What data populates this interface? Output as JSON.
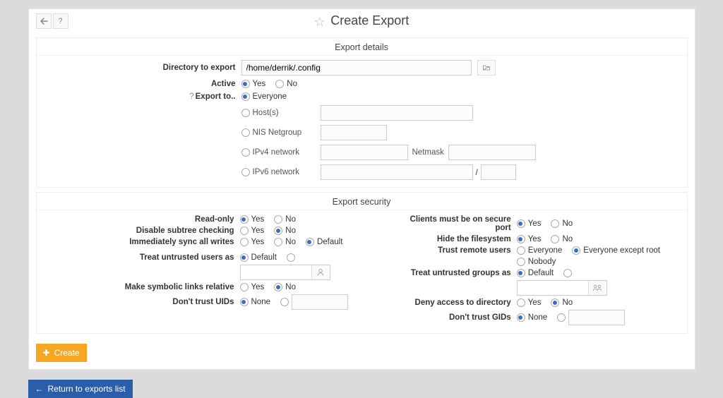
{
  "title": "Create Export",
  "sections": {
    "details": {
      "title": "Export details",
      "directory_label": "Directory to export",
      "directory_value": "/home/derrik/.config",
      "active_label": "Active",
      "yes": "Yes",
      "no": "No",
      "export_to_label": "Export to..",
      "everyone": "Everyone",
      "hosts": "Host(s)",
      "nis": "NIS Netgroup",
      "ipv4": "IPv4 network",
      "netmask": "Netmask",
      "ipv6": "IPv6 network"
    },
    "security": {
      "title": "Export security",
      "read_only": "Read-only",
      "disable_subtree": "Disable subtree checking",
      "immediate_sync": "Immediately sync all writes",
      "default": "Default",
      "treat_untrusted_users": "Treat untrusted users as",
      "make_links_relative": "Make symbolic links relative",
      "dont_trust_uids": "Don't trust UIDs",
      "none": "None",
      "clients_secure": "Clients must be on secure port",
      "hide_filesystem": "Hide the filesystem",
      "trust_remote": "Trust remote users",
      "everyone": "Everyone",
      "everyone_except_root": "Everyone except root",
      "nobody": "Nobody",
      "treat_untrusted_groups": "Treat untrusted groups as",
      "deny_access": "Deny access to directory",
      "dont_trust_gids": "Don't trust GIDs"
    }
  },
  "buttons": {
    "create": "Create",
    "return": "Return to exports list"
  }
}
